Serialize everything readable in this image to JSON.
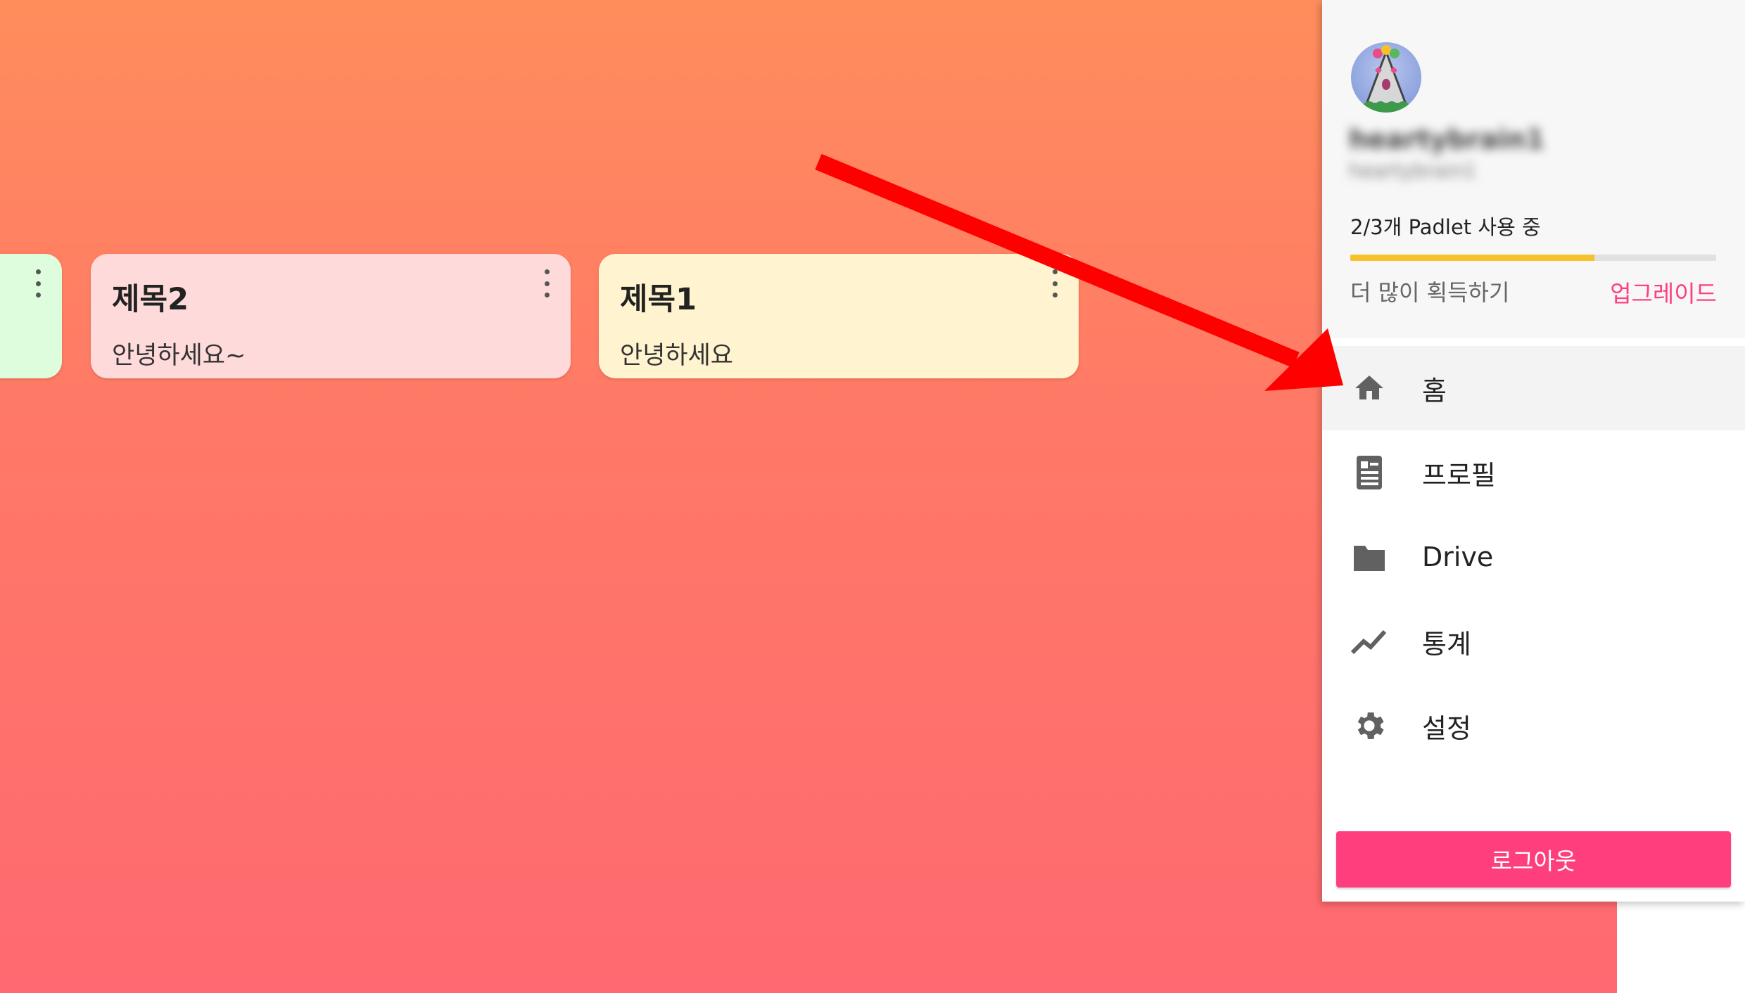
{
  "cards": [
    {
      "title": "",
      "body": "",
      "color": "#ddfddc"
    },
    {
      "title": "제목2",
      "body": "안녕하세요~",
      "color": "#ffdada"
    },
    {
      "title": "제목1",
      "body": "안녕하세요",
      "color": "#fff4cf"
    }
  ],
  "colors": {
    "background_top": "#ff8d5c",
    "background_bottom": "#ff6971",
    "accent": "#ff3f7d",
    "progress": "#f6c12b",
    "annotation_arrow": "#ff0000"
  },
  "profile": {
    "username": "heartybrain1",
    "handle": "heartybrain1",
    "usage": "2/3개 Padlet 사용 중",
    "usage_fraction": 0.667,
    "more_label": "더 많이 획득하기",
    "upgrade_label": "업그레이드"
  },
  "menu": [
    {
      "label": "홈",
      "icon": "home-icon",
      "active": true
    },
    {
      "label": "프로필",
      "icon": "profile-card-icon",
      "active": false
    },
    {
      "label": "Drive",
      "icon": "folder-icon",
      "active": false
    },
    {
      "label": "통계",
      "icon": "trending-icon",
      "active": false
    },
    {
      "label": "설정",
      "icon": "gear-icon",
      "active": false
    }
  ],
  "logout_label": "로그아웃"
}
